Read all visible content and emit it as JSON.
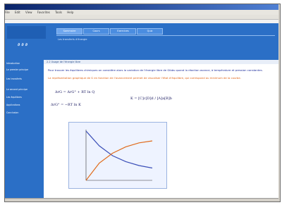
{
  "browser": {
    "menu": [
      "File",
      "Edit",
      "View",
      "Favorites",
      "Tools",
      "Help"
    ],
    "address": ""
  },
  "header": {
    "tabs": [
      "Sommaire",
      "Cours",
      "Exercices",
      "Quiz"
    ],
    "title": "",
    "subtitle": "Les transferts d'énergie"
  },
  "sidebar": {
    "items": [
      "Introduction",
      "Le premier principe",
      "Les transferts",
      "Le second principe",
      "Les équilibres",
      "Applications",
      "Conclusion"
    ]
  },
  "content": {
    "breadcrumb": "2.2 Usage de l'énergie libre",
    "paragraph1": "Pour trouver les équilibres chimiques on considère alors la variation de l'énergie libre de Gibbs quand la réaction avance, à température et pression constantes.",
    "paragraph2": "La représentation graphique de G en fonction de l'avancement permet de visualiser l'état d'équilibre, qui correspond au minimum de la courbe.",
    "formula1": "ΔrG = ΔrG° + RT ln Q",
    "formula2": "ΔrG° = −RT ln K",
    "formula3": "K = [C]c[D]d / [A]a[B]b",
    "graph_title": ""
  },
  "chart_data": {
    "type": "line",
    "series": [
      {
        "name": "",
        "values": [
          100,
          70,
          50,
          38,
          30,
          25
        ]
      },
      {
        "name": "",
        "values": [
          0,
          35,
          55,
          68,
          76,
          80
        ]
      }
    ],
    "x": [
      0,
      1,
      2,
      3,
      4,
      5
    ],
    "xlabel": "",
    "ylabel": "",
    "colors": {
      "decreasing": "#3b4fb8",
      "increasing": "#e06a1a"
    }
  }
}
